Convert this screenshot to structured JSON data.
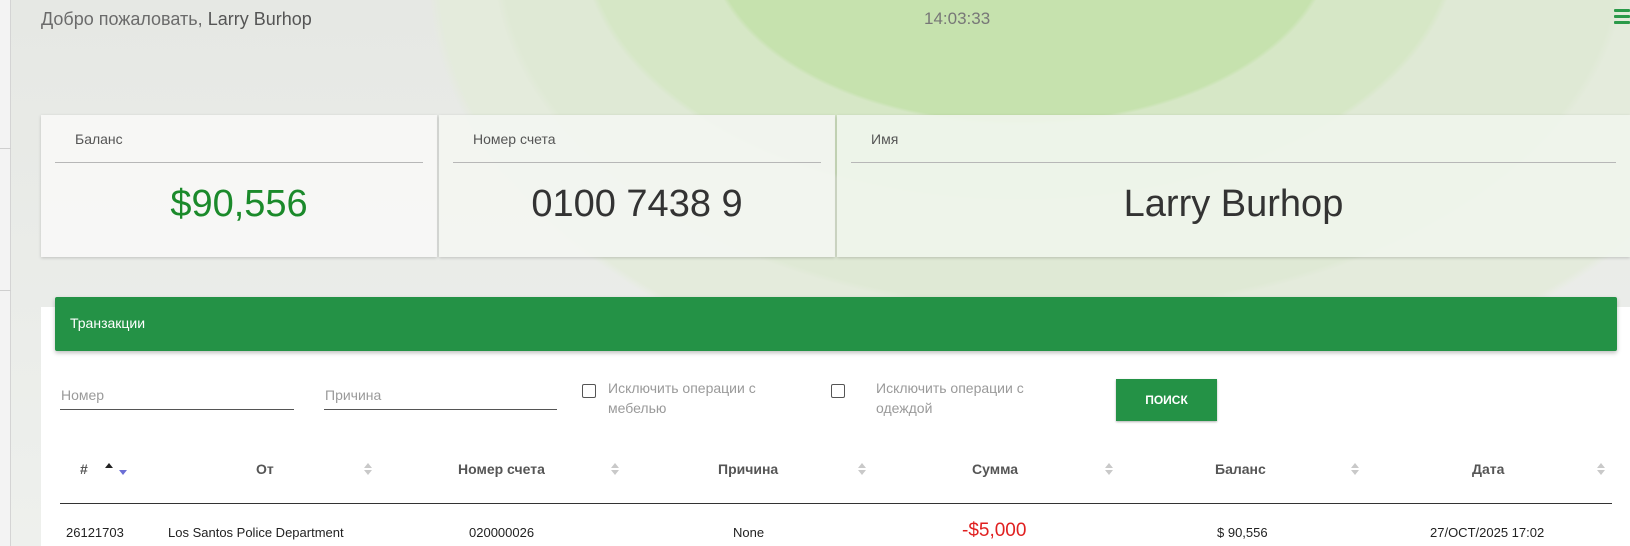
{
  "header": {
    "welcome_prefix": "Добро пожаловать,",
    "user_name": "Larry Burhop",
    "clock": "14:03:33",
    "menu_icon": "hamburger-menu-icon"
  },
  "cards": {
    "balance": {
      "label": "Баланс",
      "value": "$90,556"
    },
    "account": {
      "label": "Номер счета",
      "value": "0100 7438 9"
    },
    "name": {
      "label": "Имя",
      "value": "Larry Burhop"
    }
  },
  "transactions": {
    "title": "Транзакции",
    "filters": {
      "number_placeholder": "Номер",
      "number_value": "",
      "reason_placeholder": "Причина",
      "reason_value": "",
      "exclude_furniture_label": "Исключить операции с мебелью",
      "exclude_furniture_checked": false,
      "exclude_clothes_label": "Исключить операции с одеждой",
      "exclude_clothes_checked": false,
      "search_label": "ПОИСК"
    },
    "columns": [
      "#",
      "От",
      "Номер счета",
      "Причина",
      "Сумма",
      "Баланс",
      "Дата"
    ],
    "rows": [
      {
        "id": "26121703",
        "from": "Los Santos Police Department",
        "account": "020000026",
        "reason": "None",
        "amount": "-$5,000",
        "balance": "$ 90,556",
        "date": "27/OCT/2025 17:02"
      }
    ]
  },
  "colors": {
    "accent_green": "#249246",
    "balance_green": "#1b8a2b",
    "negative_red": "#e02020"
  }
}
